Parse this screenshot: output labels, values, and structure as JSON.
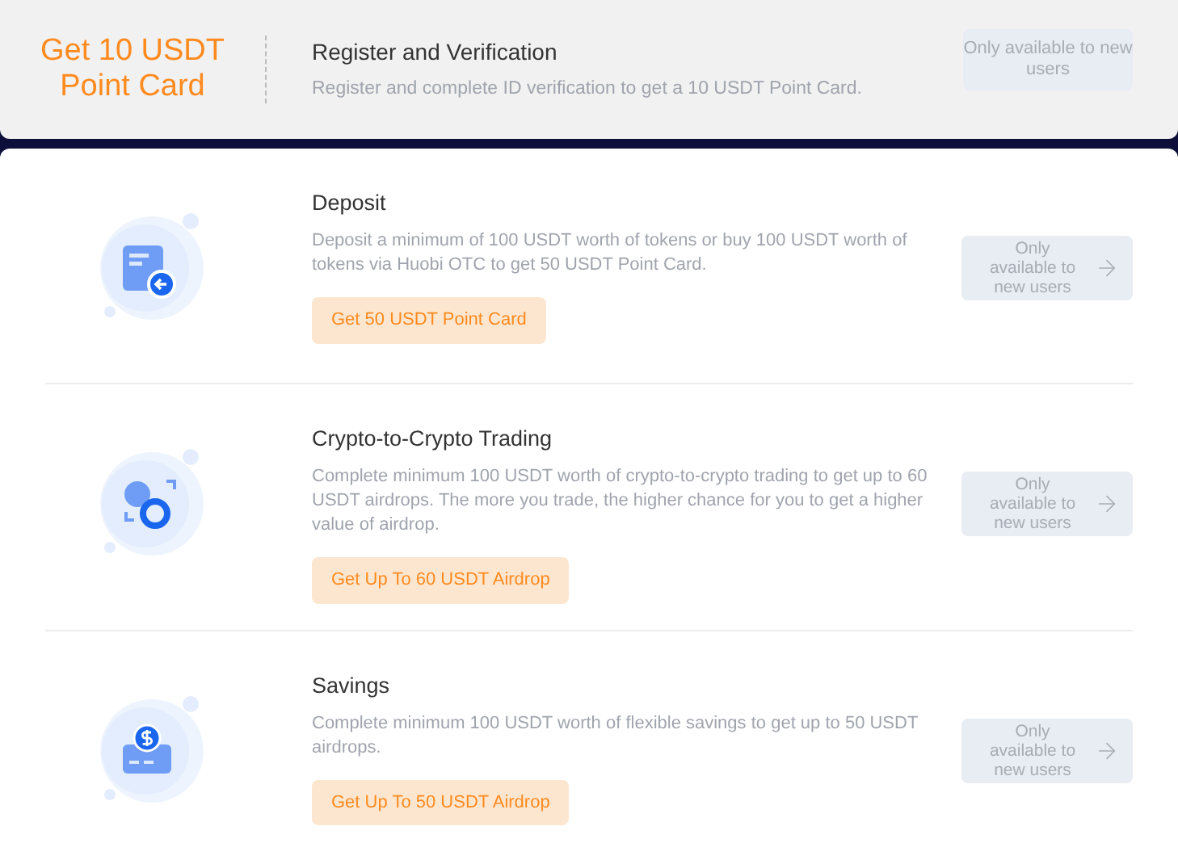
{
  "banner": {
    "reward": "Get 10 USDT Point Card",
    "title": "Register and Verification",
    "description": "Register and complete ID verification to get a 10 USDT Point Card.",
    "status": "Only available to new users"
  },
  "tasks": [
    {
      "kind": "deposit",
      "title": "Deposit",
      "description": "Deposit a minimum of 100 USDT worth of tokens or buy 100 USDT worth of tokens via Huobi OTC to get 50 USDT Point Card.",
      "reward": "Get 50 USDT Point Card",
      "status": "Only available to new users"
    },
    {
      "kind": "trading",
      "title": "Crypto-to-Crypto Trading",
      "description": "Complete minimum 100 USDT worth of crypto-to-crypto trading to get up to 60 USDT airdrops. The more you trade, the higher chance for you to get a higher value of airdrop.",
      "reward": "Get Up To 60 USDT Airdrop",
      "status": "Only available to new users"
    },
    {
      "kind": "savings",
      "title": "Savings",
      "description": "Complete minimum 100 USDT worth of flexible savings to get up to 50 USDT airdrops.",
      "reward": "Get Up To 50 USDT Airdrop",
      "status": "Only available to new users"
    }
  ]
}
